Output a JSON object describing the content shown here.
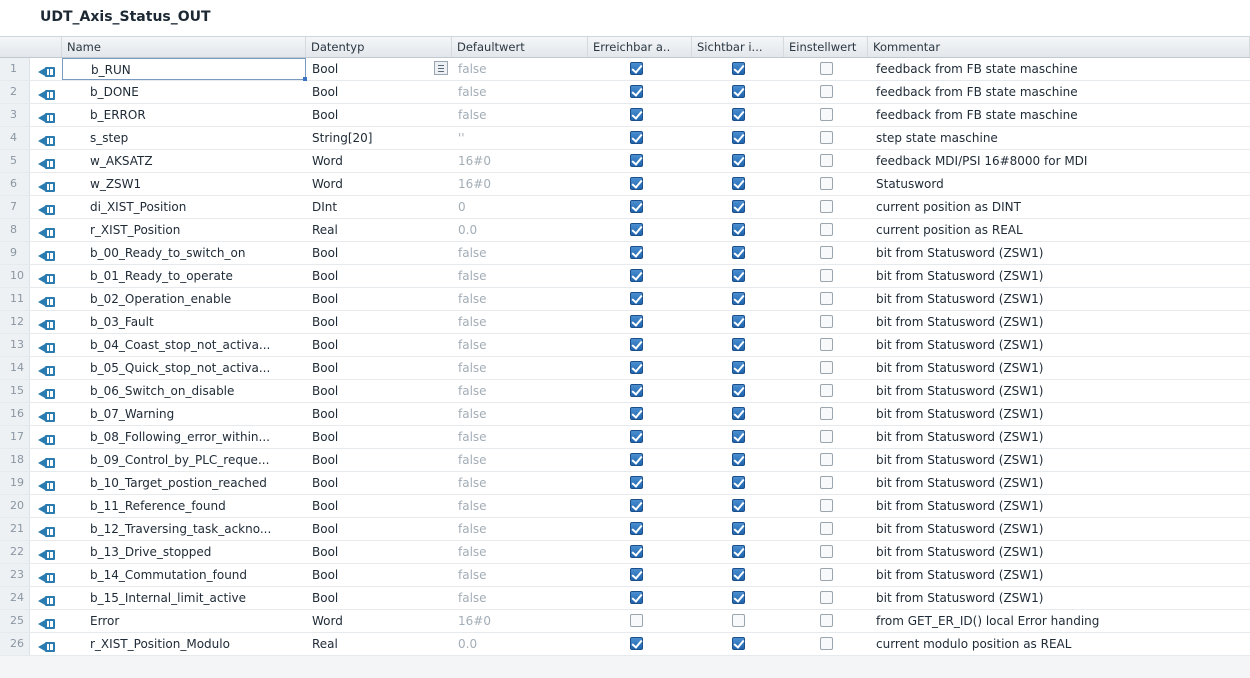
{
  "title": "UDT_Axis_Status_OUT",
  "columns": {
    "name": "Name",
    "type": "Datentyp",
    "default": "Defaultwert",
    "reach": "Erreichbar a..",
    "visible": "Sichtbar i...",
    "setvalue": "Einstellwert",
    "comment": "Kommentar"
  },
  "colors": {
    "checkbox_on": "#2a6fb8",
    "grid_line": "#e7eaed",
    "icon": "#2a7bb0"
  },
  "icon_name": "interface-output-icon",
  "rows": [
    {
      "num": "1",
      "name": "b_RUN",
      "type": "Bool",
      "default": "false",
      "reach": true,
      "visible": true,
      "set": false,
      "comment": "feedback from FB state maschine"
    },
    {
      "num": "2",
      "name": "b_DONE",
      "type": "Bool",
      "default": "false",
      "reach": true,
      "visible": true,
      "set": false,
      "comment": "feedback from FB state maschine"
    },
    {
      "num": "3",
      "name": "b_ERROR",
      "type": "Bool",
      "default": "false",
      "reach": true,
      "visible": true,
      "set": false,
      "comment": "feedback from FB state maschine"
    },
    {
      "num": "4",
      "name": "s_step",
      "type": "String[20]",
      "default": "''",
      "reach": true,
      "visible": true,
      "set": false,
      "comment": "step state maschine"
    },
    {
      "num": "5",
      "name": "w_AKSATZ",
      "type": "Word",
      "default": "16#0",
      "reach": true,
      "visible": true,
      "set": false,
      "comment": "feedback MDI/PSI  16#8000 for MDI"
    },
    {
      "num": "6",
      "name": "w_ZSW1",
      "type": "Word",
      "default": "16#0",
      "reach": true,
      "visible": true,
      "set": false,
      "comment": "Statusword"
    },
    {
      "num": "7",
      "name": "di_XIST_Position",
      "type": "DInt",
      "default": "0",
      "reach": true,
      "visible": true,
      "set": false,
      "comment": "current position as DINT"
    },
    {
      "num": "8",
      "name": "r_XIST_Position",
      "type": "Real",
      "default": "0.0",
      "reach": true,
      "visible": true,
      "set": false,
      "comment": "current position as REAL"
    },
    {
      "num": "9",
      "name": "b_00_Ready_to_switch_on",
      "type": "Bool",
      "default": "false",
      "reach": true,
      "visible": true,
      "set": false,
      "comment": "bit from Statusword (ZSW1)"
    },
    {
      "num": "10",
      "name": "b_01_Ready_to_operate",
      "type": "Bool",
      "default": "false",
      "reach": true,
      "visible": true,
      "set": false,
      "comment": "bit from Statusword (ZSW1)"
    },
    {
      "num": "11",
      "name": "b_02_Operation_enable",
      "type": "Bool",
      "default": "false",
      "reach": true,
      "visible": true,
      "set": false,
      "comment": "bit from Statusword (ZSW1)"
    },
    {
      "num": "12",
      "name": "b_03_Fault",
      "type": "Bool",
      "default": "false",
      "reach": true,
      "visible": true,
      "set": false,
      "comment": "bit from Statusword (ZSW1)"
    },
    {
      "num": "13",
      "name": "b_04_Coast_stop_not_activa...",
      "type": "Bool",
      "default": "false",
      "reach": true,
      "visible": true,
      "set": false,
      "comment": "bit from Statusword (ZSW1)"
    },
    {
      "num": "14",
      "name": "b_05_Quick_stop_not_activa...",
      "type": "Bool",
      "default": "false",
      "reach": true,
      "visible": true,
      "set": false,
      "comment": "bit from Statusword (ZSW1)"
    },
    {
      "num": "15",
      "name": "b_06_Switch_on_disable",
      "type": "Bool",
      "default": "false",
      "reach": true,
      "visible": true,
      "set": false,
      "comment": "bit from Statusword (ZSW1)"
    },
    {
      "num": "16",
      "name": "b_07_Warning",
      "type": "Bool",
      "default": "false",
      "reach": true,
      "visible": true,
      "set": false,
      "comment": "bit from Statusword (ZSW1)"
    },
    {
      "num": "17",
      "name": "b_08_Following_error_within...",
      "type": "Bool",
      "default": "false",
      "reach": true,
      "visible": true,
      "set": false,
      "comment": "bit from Statusword (ZSW1)"
    },
    {
      "num": "18",
      "name": "b_09_Control_by_PLC_reque...",
      "type": "Bool",
      "default": "false",
      "reach": true,
      "visible": true,
      "set": false,
      "comment": "bit from Statusword (ZSW1)"
    },
    {
      "num": "19",
      "name": "b_10_Target_postion_reached",
      "type": "Bool",
      "default": "false",
      "reach": true,
      "visible": true,
      "set": false,
      "comment": "bit from Statusword (ZSW1)"
    },
    {
      "num": "20",
      "name": "b_11_Reference_found",
      "type": "Bool",
      "default": "false",
      "reach": true,
      "visible": true,
      "set": false,
      "comment": "bit from Statusword (ZSW1)"
    },
    {
      "num": "21",
      "name": "b_12_Traversing_task_ackno...",
      "type": "Bool",
      "default": "false",
      "reach": true,
      "visible": true,
      "set": false,
      "comment": "bit from Statusword (ZSW1)"
    },
    {
      "num": "22",
      "name": "b_13_Drive_stopped",
      "type": "Bool",
      "default": "false",
      "reach": true,
      "visible": true,
      "set": false,
      "comment": "bit from Statusword (ZSW1)"
    },
    {
      "num": "23",
      "name": "b_14_Commutation_found",
      "type": "Bool",
      "default": "false",
      "reach": true,
      "visible": true,
      "set": false,
      "comment": "bit from Statusword (ZSW1)"
    },
    {
      "num": "24",
      "name": "b_15_Internal_limit_active",
      "type": "Bool",
      "default": "false",
      "reach": true,
      "visible": true,
      "set": false,
      "comment": "bit from Statusword (ZSW1)"
    },
    {
      "num": "25",
      "name": "Error",
      "type": "Word",
      "default": "16#0",
      "reach": false,
      "visible": false,
      "set": false,
      "comment": "from GET_ER_ID() local Error handing"
    },
    {
      "num": "26",
      "name": "r_XIST_Position_Modulo",
      "type": "Real",
      "default": "0.0",
      "reach": true,
      "visible": true,
      "set": false,
      "comment": "current modulo position as REAL"
    }
  ]
}
